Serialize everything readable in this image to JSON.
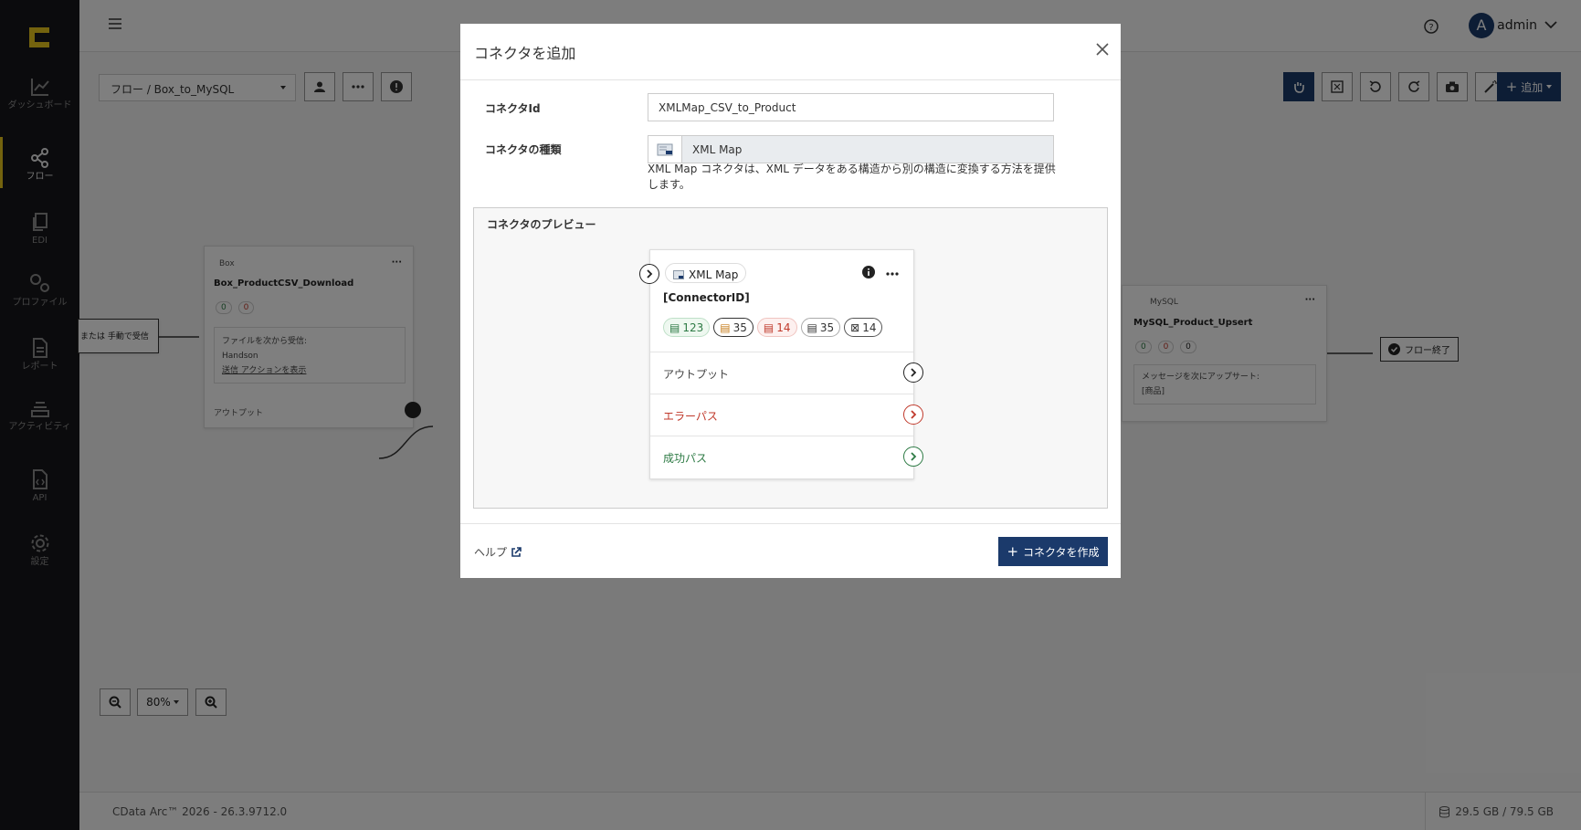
{
  "sidebar": {
    "items": [
      {
        "label": "ダッシュボード",
        "icon": "chart-line-icon"
      },
      {
        "label": "フロー",
        "icon": "share-nodes-icon",
        "active": true
      },
      {
        "label": "EDI",
        "icon": "copy-icon"
      },
      {
        "label": "プロファイル",
        "icon": "gears-icon"
      },
      {
        "label": "レポート",
        "icon": "file-lines-icon"
      },
      {
        "label": "アクティビティ",
        "icon": "layers-icon"
      },
      {
        "label": "API",
        "icon": "file-code-icon"
      },
      {
        "label": "設定",
        "icon": "gear-icon"
      }
    ]
  },
  "header": {
    "username": "admin",
    "avatar_letter": "A"
  },
  "canvas": {
    "flow_select": "フロー /   Box_to_MySQL",
    "add_label": "追加",
    "zoom_level": "80%",
    "box_node": {
      "type": "Box",
      "name": "Box_ProductCSV_Download",
      "success": "0",
      "error": "0",
      "recv_label": "ファイルを次から受信:",
      "recv_value": "Handson",
      "action_link": "送信 アクションを表示",
      "output": "アウトプット"
    },
    "trigger_text": "または 手動で受信",
    "mysql_node": {
      "type": "MySQL",
      "name": "MySQL_Product_Upsert",
      "c1": "0",
      "c2": "0",
      "c3": "0",
      "action": "メッセージを次にアップサート:",
      "table": "[商品]"
    },
    "end_label": "フロー終了"
  },
  "footer": {
    "version": "CData Arc™ 2026 - 26.3.9712.0",
    "disk": "29.5 GB / 79.5 GB"
  },
  "modal": {
    "title": "コネクタを追加",
    "id_label": "コネクタId",
    "id_value": "XMLMap_CSV_to_Product",
    "type_label": "コネクタの種類",
    "type_value": "XML Map",
    "description": "XML Map コネクタは、XML データをある構造から別の構造に変換する方法を提供します。",
    "preview_label": "コネクタのプレビュー",
    "card": {
      "type": "XML Map",
      "id": "[ConnectorID]",
      "stats": [
        "123",
        "35",
        "14",
        "35",
        "14"
      ],
      "ports": [
        "アウトプット",
        "エラーパス",
        "成功パス"
      ]
    },
    "help": "ヘルプ",
    "create": "コネクタを作成"
  },
  "colors": {
    "primary": "#1b3a6b",
    "sidebar": "#17171a",
    "accent": "#e8c61c",
    "error": "#c0392b",
    "success": "#2d7a44"
  }
}
